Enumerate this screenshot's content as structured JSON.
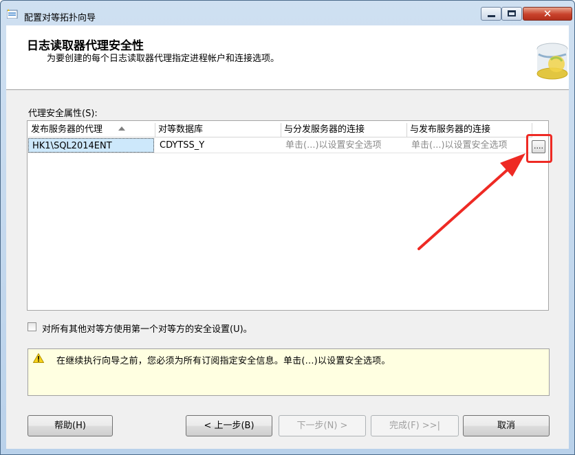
{
  "window": {
    "title": "配置对等拓扑向导",
    "close_glyph": "✕"
  },
  "header": {
    "title": "日志读取器代理安全性",
    "subtitle": "为要创建的每个日志读取器代理指定进程帐户和连接选项。",
    "icon": "database-wizard-icon"
  },
  "grid": {
    "label": "代理安全属性(S):",
    "columns": [
      "发布服务器的代理",
      "对等数据库",
      "与分发服务器的连接",
      "与发布服务器的连接"
    ],
    "rows": [
      {
        "agent": "HK1\\SQL2014ENT",
        "database": "CDYTSS_Y",
        "distributor_conn": "单击(...)以设置安全选项",
        "publisher_conn": "单击(...)以设置安全选项"
      }
    ],
    "ellipsis_label": "...."
  },
  "checkbox": {
    "label": "对所有其他对等方使用第一个对等方的安全设置(U)。",
    "checked": false
  },
  "message": {
    "text": "在继续执行向导之前，您必须为所有订阅指定安全信息。单击(...)以设置安全选项。",
    "icon": "warning-icon"
  },
  "buttons": {
    "help": "帮助(H)",
    "prev": "< 上一步(B)",
    "next": "下一步(N) >",
    "finish": "完成(F) >>|",
    "cancel": "取消"
  },
  "colors": {
    "highlight": "#ee2a24",
    "selection": "#cde8fb",
    "message_bg": "#ffffe1"
  }
}
